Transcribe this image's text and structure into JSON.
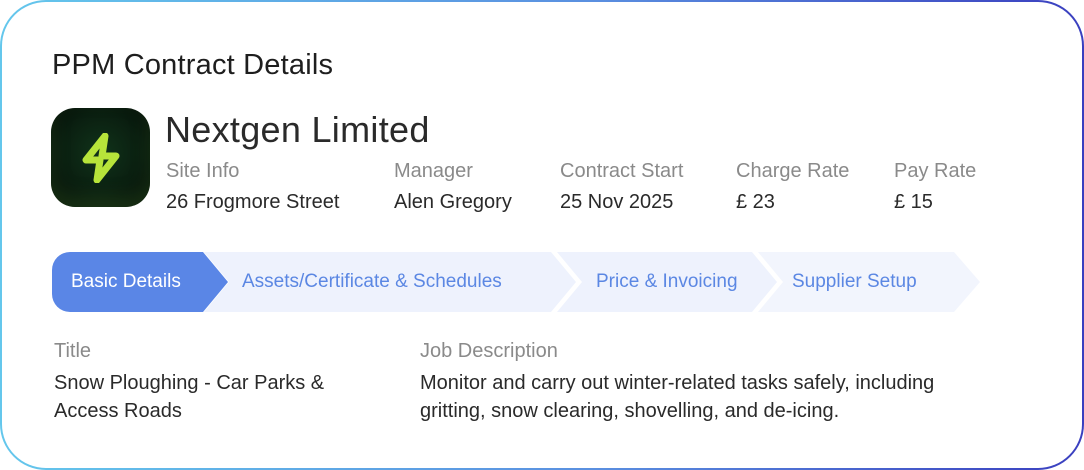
{
  "page_title": "PPM Contract Details",
  "company": {
    "name": "Nextgen Limited",
    "logo_icon": "lightning-bolt-icon",
    "logo_colors": {
      "bolt": "#b7e43a",
      "background": "#0a1e10"
    }
  },
  "info": [
    {
      "label": "Site Info",
      "value": "26 Frogmore Street"
    },
    {
      "label": "Manager",
      "value": "Alen Gregory"
    },
    {
      "label": "Contract Start",
      "value": "25 Nov 2025"
    },
    {
      "label": "Charge Rate",
      "value": "£ 23"
    },
    {
      "label": "Pay Rate",
      "value": "£ 15"
    }
  ],
  "steps": [
    {
      "label": "Basic Details",
      "active": true
    },
    {
      "label": "Assets/Certificate & Schedules",
      "active": false
    },
    {
      "label": "Price & Invoicing",
      "active": false
    },
    {
      "label": "Supplier Setup",
      "active": false
    }
  ],
  "details": {
    "title_label": "Title",
    "title_lines": [
      "Snow Ploughing - Car Parks &",
      "Access Roads"
    ],
    "description_label": "Job Description",
    "description_lines": [
      "Monitor and carry out winter-related tasks safely, including",
      "gritting, snow clearing, shovelling, and de-icing."
    ]
  },
  "colors": {
    "accent": "#5a86e6",
    "step_inactive_bg": "#eef2fd",
    "step_inactive_text": "#5b87e3",
    "border_gradient": [
      "#64c7ec",
      "#3a3fbf"
    ]
  }
}
